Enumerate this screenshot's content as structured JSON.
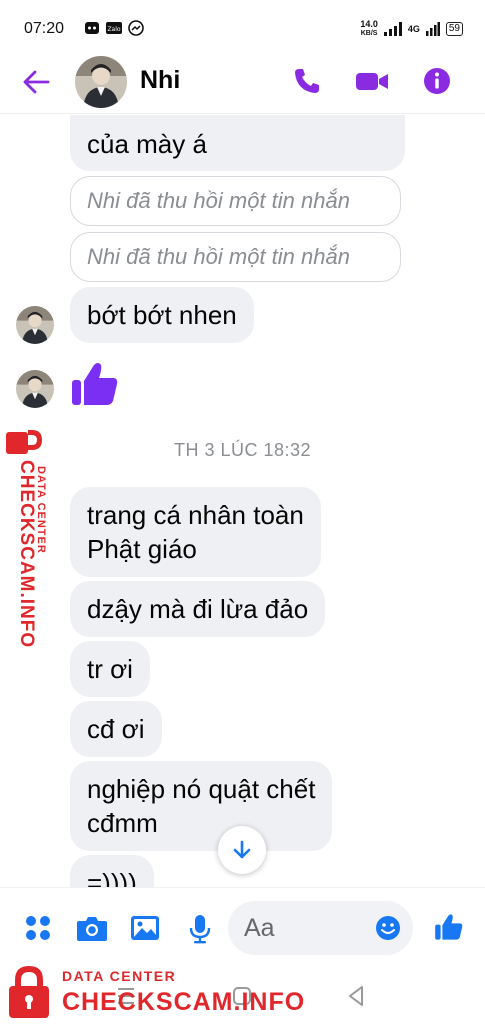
{
  "status_bar": {
    "time": "07:20",
    "net_speed_value": "14.0",
    "net_speed_unit": "KB/S",
    "network": "4G",
    "battery": "59"
  },
  "header": {
    "contact_name": "Nhi",
    "accent_color": "#8a2be2"
  },
  "messages": {
    "partial_top": "của mày á",
    "recalled_1": "Nhi đã thu hồi một tin nhắn",
    "recalled_2": "Nhi đã thu hồi một tin nhắn",
    "msg_bot_bot": "bớt bớt nhen",
    "like_sticker": "thumbs-up-sticker",
    "divider": "TH 3 LÚC 18:32",
    "msg_1_line1": "trang cá nhân toàn",
    "msg_1_line2": "Phật giáo",
    "msg_2": "dzậy mà đi lừa đảo",
    "msg_3": "tr ơi",
    "msg_4": "cđ ơi",
    "msg_5_line1": "nghiệp nó quật chết",
    "msg_5_line2": "cđmm",
    "msg_6": "=))))"
  },
  "composer": {
    "placeholder": "Aa"
  },
  "watermark": {
    "side_small": "DATA CENTER",
    "side_main": "CHECKSCAM.INFO",
    "bottom_small": "DATA CENTER",
    "bottom_main": "CHECKSCAM.INFO",
    "color": "#e0272b"
  }
}
